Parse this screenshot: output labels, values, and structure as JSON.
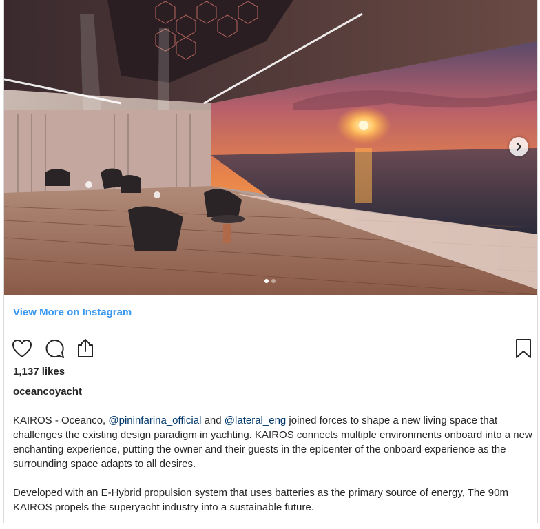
{
  "post": {
    "image_description_icon": "yacht-interior-sunset-image",
    "carousel": {
      "next_icon": "chevron-right-icon",
      "total_slides": 2,
      "active_slide": 1
    },
    "view_more_label": "View More on Instagram",
    "actions": {
      "like_icon": "heart-icon",
      "comment_icon": "comment-icon",
      "share_icon": "share-icon",
      "save_icon": "bookmark-icon"
    },
    "likes_text": "1,137 likes",
    "username": "oceancoyacht",
    "caption": {
      "p1_a": "KAIROS - Oceanco, ",
      "mention1": "@pininfarina_official",
      "p1_b": " and ",
      "mention2": "@lateral_eng",
      "p1_c": " joined forces to shape a new living space that challenges the existing design paradigm in yachting. KAIROS connects multiple environments onboard into a new enchanting experience, putting the owner and their guests in the epicenter of the onboard experience as the surrounding space adapts to all desires.",
      "p2": "Developed with an E-Hybrid propulsion system that uses batteries as the primary source of energy, The 90m KAIROS propels the superyacht industry into a sustainable future."
    },
    "colors": {
      "link": "#3897f0",
      "mention": "#00376b",
      "text": "#262626"
    }
  }
}
